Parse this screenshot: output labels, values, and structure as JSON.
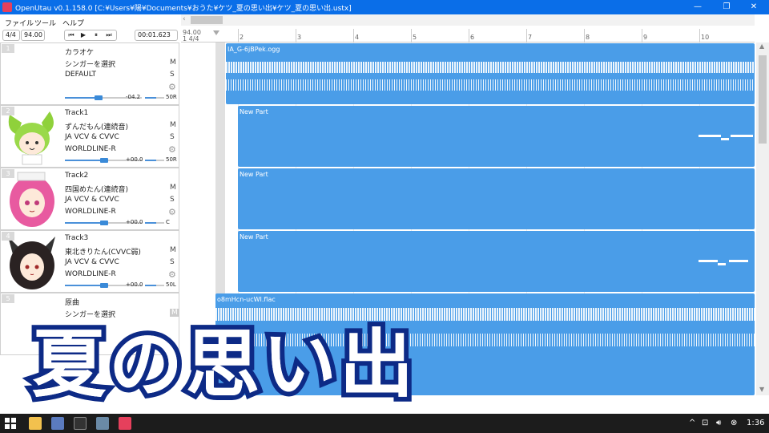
{
  "window": {
    "title": "OpenUtau v0.1.158.0 [C:¥Users¥陽¥Documents¥おうた¥ケツ_夏の思い出¥ケツ_夏の思い出.ustx]",
    "minimize": "—",
    "maximize": "❐",
    "close": "✕"
  },
  "menu": {
    "file": "ファイル",
    "tools": "ツール",
    "help": "ヘルプ"
  },
  "transport": {
    "time_signature": "4/4",
    "bpm": "94.00",
    "position": "00:01.623",
    "buttons": [
      "⏮",
      "▶",
      "⏸",
      "⏭"
    ]
  },
  "timeline": {
    "bpm_label": "94.00",
    "ts_label": "1 4/4",
    "bars": [
      "2",
      "3",
      "4",
      "5",
      "6",
      "7",
      "8",
      "9",
      "10"
    ]
  },
  "tracks": [
    {
      "number": "1",
      "name": "カラオケ",
      "singer": "シンガーを選択",
      "phonemizer": "DEFAULT",
      "renderer": "",
      "mute": "M",
      "solo": "S",
      "volume": "-04.2",
      "volume_level": 0.6,
      "pan": "50R"
    },
    {
      "number": "2",
      "name": "Track1",
      "singer": "ずんだもん(連続音)",
      "phonemizer": "JA VCV & CVVC",
      "renderer": "WORLDLINE-R",
      "mute": "M",
      "solo": "S",
      "volume": "+00.0",
      "volume_level": 0.7,
      "pan": "50R"
    },
    {
      "number": "3",
      "name": "Track2",
      "singer": "四国めたん(連続音)",
      "phonemizer": "JA VCV & CVVC",
      "renderer": "WORLDLINE-R",
      "mute": "M",
      "solo": "S",
      "volume": "+00.0",
      "volume_level": 0.7,
      "pan": "C"
    },
    {
      "number": "4",
      "name": "Track3",
      "singer": "東北きりたん(CVVC弱)",
      "phonemizer": "JA VCV & CVVC",
      "renderer": "WORLDLINE-R",
      "mute": "M",
      "solo": "S",
      "volume": "+00.0",
      "volume_level": 0.7,
      "pan": "50L"
    },
    {
      "number": "5",
      "name": "原曲",
      "singer": "シンガーを選択",
      "phonemizer": "",
      "renderer": "",
      "mute": "M",
      "solo": "S",
      "volume": "",
      "volume_level": 0.7,
      "pan": ""
    }
  ],
  "parts": [
    {
      "label": "IA_G-6jBPek.ogg",
      "kind": "wave"
    },
    {
      "label": "New Part",
      "kind": "voice"
    },
    {
      "label": "New Part",
      "kind": "voice"
    },
    {
      "label": "New Part",
      "kind": "voice"
    },
    {
      "label": "o8mHcn-ucWI.flac",
      "kind": "wave"
    }
  ],
  "overlay": {
    "title": "夏の思い出"
  },
  "taskbar": {
    "clock": "1:36",
    "tray_up": "^"
  },
  "colors": {
    "accent": "#0a6ee8",
    "part": "#4a9de8",
    "overlay_stroke": "#0d2a86"
  }
}
